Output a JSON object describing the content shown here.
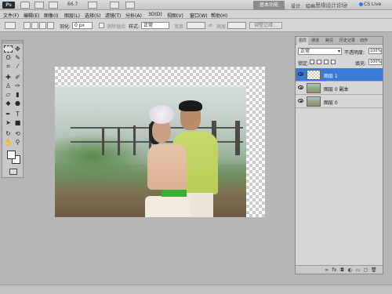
{
  "titlebar": {
    "logo": "Ps",
    "zoom": "66.7",
    "workspace_label": "基本功能",
    "design_label": "设计",
    "paint_label": "绘画",
    "more_label": "»",
    "watermark": "思缘设计论坛 WWW.MISSYUAN.COM",
    "cslive_label": "CS Live"
  },
  "menu": [
    "文件(F)",
    "编辑(E)",
    "图像(I)",
    "图层(L)",
    "选择(S)",
    "滤镜(T)",
    "分析(A)",
    "3D(D)",
    "视图(V)",
    "窗口(W)",
    "帮助(H)"
  ],
  "options": {
    "feather_label": "羽化:",
    "feather_value": "0 px",
    "antialias_label": "消除锯齿",
    "style_label": "样式:",
    "style_value": "正常",
    "width_label": "宽度:",
    "height_label": "高度:",
    "refine_label": "调整边缘..."
  },
  "layers_panel": {
    "tabs": [
      "图层",
      "通道",
      "路径",
      "历史记录",
      "动作"
    ],
    "blend_mode": "正常",
    "opacity_label": "不透明度:",
    "opacity_value": "100%",
    "lock_label": "锁定:",
    "fill_label": "填充:",
    "fill_value": "100%",
    "layers": [
      {
        "name": "图层 1",
        "selected": true,
        "thumb": "transparent"
      },
      {
        "name": "图层 0 副本",
        "selected": false,
        "thumb": "photo"
      },
      {
        "name": "图层 0",
        "selected": false,
        "thumb": "photo"
      }
    ],
    "footer_icons": [
      "link-icon",
      "fx-icon",
      "mask-icon",
      "adjustment-icon",
      "group-icon",
      "new-layer-icon",
      "trash-icon"
    ]
  }
}
